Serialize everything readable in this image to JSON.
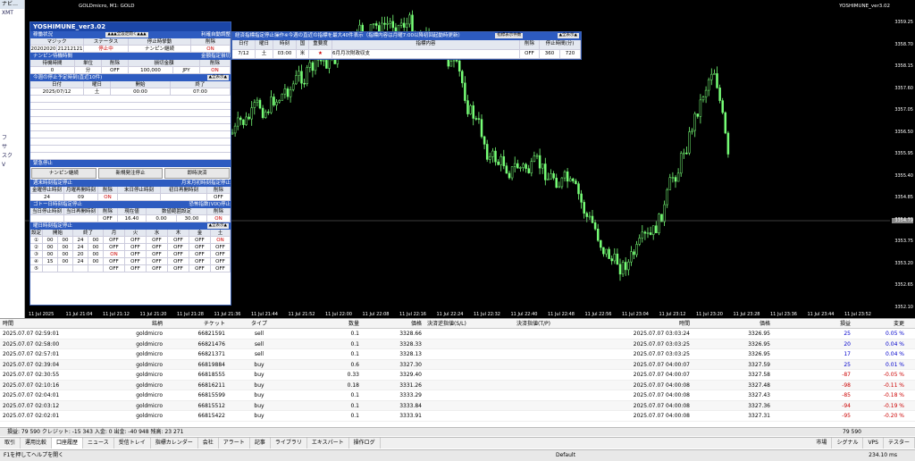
{
  "nav": {
    "title": "ナビ…",
    "items": [
      "XMT",
      "",
      "",
      "",
      "",
      "",
      "",
      "",
      "",
      "",
      "",
      "",
      "",
      "",
      "フ",
      "サ",
      "スク",
      "V"
    ]
  },
  "chart": {
    "title": "GOLDmicro, M1: GOLD",
    "name": "YOSHIMUNE_ver3.02",
    "y_labels": [
      "3359.25",
      "3358.70",
      "3358.15",
      "3357.60",
      "3357.05",
      "3356.50",
      "3355.95",
      "3355.40",
      "3354.85",
      "3354.30",
      "3353.75",
      "3353.20",
      "3352.65",
      "3352.10"
    ],
    "current_price": "3354.79",
    "x_labels": [
      "11 Jul 2025",
      "11 Jul 21:04",
      "11 Jul 21:12",
      "11 Jul 21:20",
      "11 Jul 21:28",
      "11 Jul 21:36",
      "11 Jul 21:44",
      "11 Jul 21:52",
      "11 Jul 22:00",
      "11 Jul 22:08",
      "11 Jul 22:16",
      "11 Jul 22:24",
      "11 Jul 22:32",
      "11 Jul 22:40",
      "11 Jul 22:48",
      "11 Jul 22:56",
      "11 Jul 23:04",
      "11 Jul 23:12",
      "11 Jul 23:20",
      "11 Jul 23:28",
      "11 Jul 23:36",
      "11 Jul 23:44",
      "11 Jul 23:52"
    ]
  },
  "panel": {
    "title": "YOSHIMUNE_ver3.02",
    "s1": "稼働状況",
    "s1b": "▲▲▲全設定開く▲▲▲",
    "s1r": "利確自動調整",
    "h1": [
      "マジック",
      "ステータス",
      "停止時挙動",
      "削除"
    ],
    "r1": [
      "20202020",
      "21212121",
      "停止中",
      "ナンピン継続",
      "ON"
    ],
    "s2": "ナンピン待機時間",
    "s2r": "金額指定損切",
    "h2": [
      "待機時間",
      "単位",
      "削除",
      "損切金額",
      "削除"
    ],
    "r2": [
      "0",
      "分",
      "OFF",
      "100,000",
      "JPY",
      "ON"
    ],
    "s3": "今週の停止予定時刻(直近10件)",
    "s3b": "▲全表示▲",
    "h3": [
      "日付",
      "曜日",
      "停止時刻",
      "開始",
      "終了"
    ],
    "r3": [
      "2025/07/12",
      "土",
      "00:00",
      "07:00"
    ],
    "s4": "緊急停止",
    "btn": [
      "ナンピン継続",
      "新規発注停止",
      "即時決済"
    ],
    "s5": "週末時刻指定停止",
    "s5r": "月末月初時刻指定停止",
    "h5": [
      "金曜停止時刻",
      "月曜再開時刻",
      "削除",
      "末日停止時刻",
      "初日再開時刻",
      "削除"
    ],
    "r5": [
      "24",
      "00",
      "09",
      "00",
      "ON",
      "OFF"
    ],
    "s6": "ゴトー日時刻指定停止",
    "s6r": "恐怖指数(VIX)停止",
    "h6": [
      "当日停止時刻",
      "当日再開時刻",
      "削除",
      "現在値",
      "数値範囲設定",
      "下限値",
      "上限値",
      "削除"
    ],
    "r6": [
      "OFF",
      "16.40",
      "0.00",
      "30.00",
      "ON"
    ],
    "s7": "曜日時刻指定停止",
    "s7b": "▲全表示▲",
    "h7": [
      "設定",
      "停止時刻",
      "停止曜日",
      "開始",
      "終了",
      "月",
      "火",
      "水",
      "木",
      "金",
      "土"
    ],
    "r7": [
      [
        "①",
        "00",
        "00",
        "24",
        "00",
        "OFF",
        "OFF",
        "OFF",
        "OFF",
        "OFF",
        "ON"
      ],
      [
        "②",
        "00",
        "00",
        "24",
        "00",
        "OFF",
        "OFF",
        "OFF",
        "OFF",
        "OFF",
        "OFF"
      ],
      [
        "③",
        "00",
        "00",
        "20",
        "00",
        "ON",
        "OFF",
        "OFF",
        "OFF",
        "OFF",
        "OFF"
      ],
      [
        "④",
        "15",
        "00",
        "24",
        "00",
        "OFF",
        "OFF",
        "OFF",
        "OFF",
        "OFF",
        "OFF"
      ],
      [
        "⑤",
        "",
        "",
        "",
        "",
        "OFF",
        "OFF",
        "OFF",
        "OFF",
        "OFF",
        "OFF"
      ]
    ]
  },
  "econ": {
    "title": "経済指標指定停止操作※今週の直近の指標を最大40件表示（指標内容は月曜7:00以降初回起動時更新）",
    "btn": "指標表示件数",
    "btn2": "▲全表示▲",
    "h": [
      "日付",
      "曜日",
      "時刻",
      "国",
      "重要度",
      "指標内容",
      "削除",
      "停止時間(分)",
      "指標前",
      "指標後"
    ],
    "r": [
      "7/12",
      "土",
      "03:00",
      "米",
      "★",
      "6月月次財政収支",
      "OFF",
      "360",
      "720"
    ]
  },
  "terminal": {
    "headers": [
      "時間",
      "銘柄",
      "チケット",
      "タイプ",
      "数量",
      "価格",
      "決済逆指値(S/L)",
      "決済指値(T/P)",
      "時間",
      "価格",
      "損益",
      "変更"
    ],
    "rows": [
      [
        "2025.07.07 02:59:01",
        "goldmicro",
        "66821591",
        "sell",
        "0.1",
        "3328.66",
        "",
        "",
        "2025.07.07 03:03:24",
        "3326.95",
        "25",
        "0.05 %"
      ],
      [
        "2025.07.07 02:58:00",
        "goldmicro",
        "66821476",
        "sell",
        "0.1",
        "3328.33",
        "",
        "",
        "2025.07.07 03:03:25",
        "3326.95",
        "20",
        "0.04 %"
      ],
      [
        "2025.07.07 02:57:01",
        "goldmicro",
        "66821371",
        "sell",
        "0.1",
        "3328.13",
        "",
        "",
        "2025.07.07 03:03:25",
        "3326.95",
        "17",
        "0.04 %"
      ],
      [
        "2025.07.07 02:39:04",
        "goldmicro",
        "66819884",
        "buy",
        "0.6",
        "3327.30",
        "",
        "",
        "2025.07.07 04:00:07",
        "3327.59",
        "25",
        "0.01 %"
      ],
      [
        "2025.07.07 02:30:55",
        "goldmicro",
        "66818555",
        "buy",
        "0.33",
        "3329.40",
        "",
        "",
        "2025.07.07 04:00:07",
        "3327.58",
        "-87",
        "-0.05 %"
      ],
      [
        "2025.07.07 02:10:16",
        "goldmicro",
        "66816211",
        "buy",
        "0.18",
        "3331.26",
        "",
        "",
        "2025.07.07 04:00:08",
        "3327.48",
        "-98",
        "-0.11 %"
      ],
      [
        "2025.07.07 02:04:01",
        "goldmicro",
        "66815599",
        "buy",
        "0.1",
        "3333.29",
        "",
        "",
        "2025.07.07 04:00:08",
        "3327.43",
        "-85",
        "-0.18 %"
      ],
      [
        "2025.07.07 02:03:12",
        "goldmicro",
        "66815512",
        "buy",
        "0.1",
        "3333.84",
        "",
        "",
        "2025.07.07 04:00:08",
        "3327.36",
        "-94",
        "-0.19 %"
      ],
      [
        "2025.07.07 02:02:01",
        "goldmicro",
        "66815422",
        "buy",
        "0.1",
        "3333.91",
        "",
        "",
        "2025.07.07 04:00:08",
        "3327.31",
        "-95",
        "-0.20 %"
      ]
    ],
    "summary": "損益: 79 590  クレジット: -15 343  入金: 0  出金: -40 948  残高: 23 271",
    "total": "79 590"
  },
  "tabs": [
    "取引",
    "運用比較",
    "口座履歴",
    "ニュース",
    "受信トレイ",
    "指標カレンダー",
    "会社",
    "アラート",
    "記事",
    "ライブラリ",
    "エキスパート",
    "操作ログ"
  ],
  "tabs_right": [
    "市場",
    "シグナル",
    "VPS",
    "テスター"
  ],
  "status": {
    "help": "F1を押してヘルプを開く",
    "profile": "Default",
    "ping": "234.10 ms"
  }
}
